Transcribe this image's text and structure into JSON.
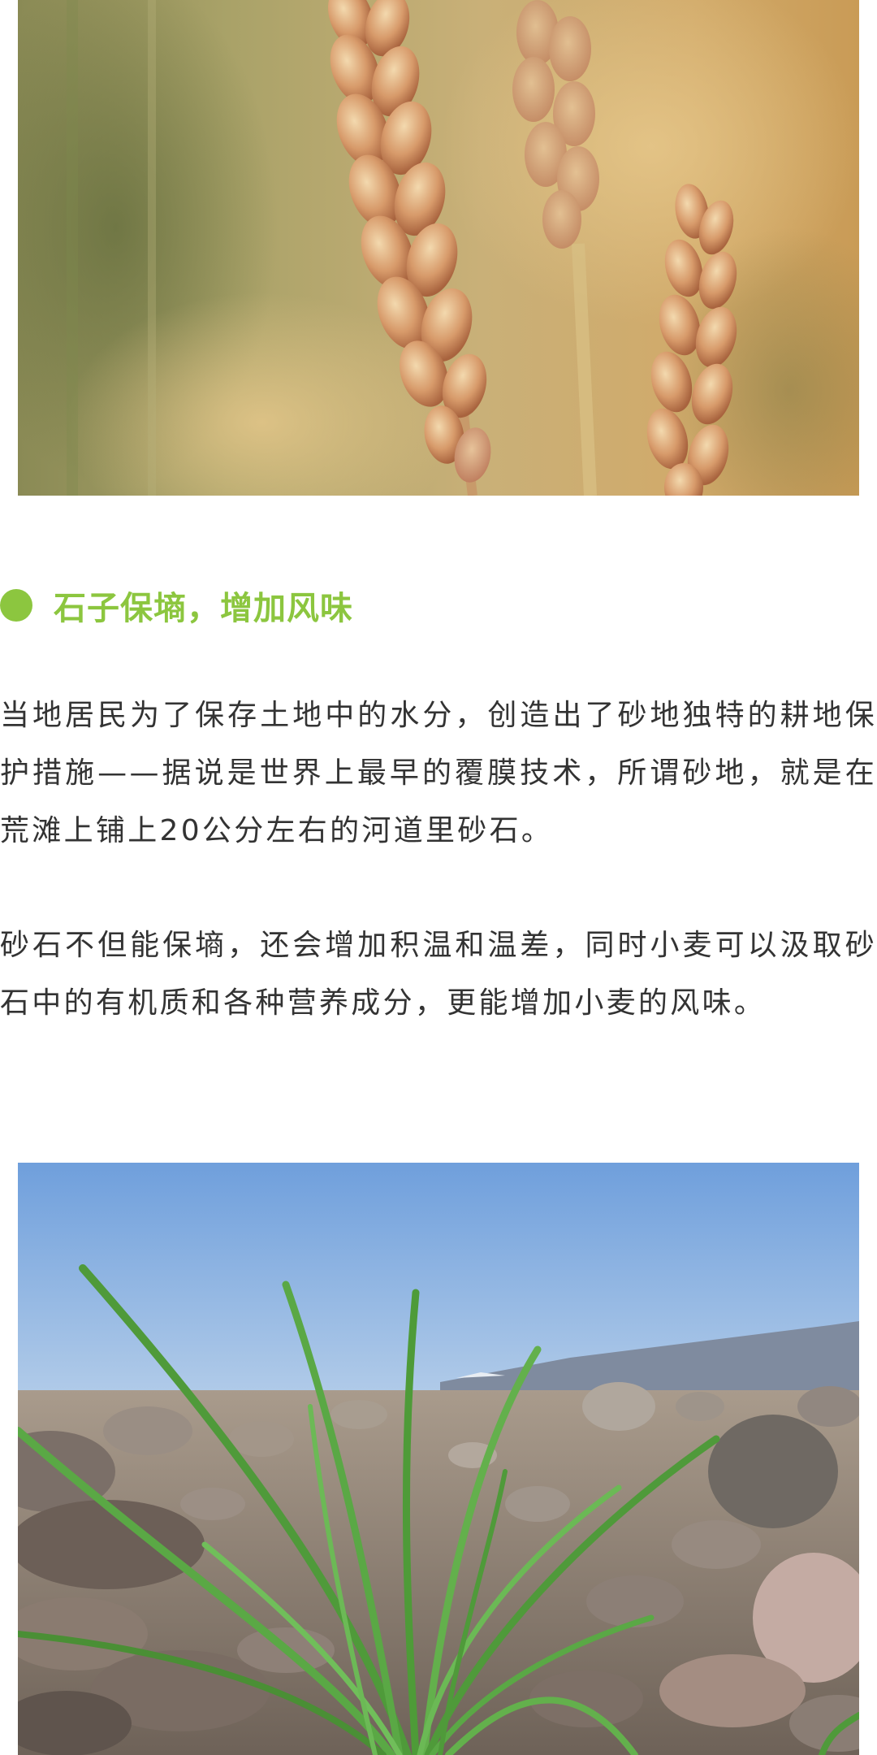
{
  "article": {
    "top_image": {
      "subject": "wheat-ears-photo"
    },
    "section_heading": "石子保墒，增加风味",
    "paragraphs": [
      "当地居民为了保存土地中的水分，创造出了砂地独特的耕地保护措施——据说是世界上最早的覆膜技术，所谓砂地，就是在荒滩上铺上20公分左右的河道里砂石。",
      "砂石不但能保墒，还会增加积温和温差，同时小麦可以汲取砂石中的有机质和各种营养成分，更能增加小麦的风味。"
    ],
    "bottom_image": {
      "subject": "wheat-seedlings-in-gravel-photo"
    }
  },
  "colors": {
    "accent": "#8cc63f",
    "body_text": "#333333",
    "background": "#ffffff"
  }
}
